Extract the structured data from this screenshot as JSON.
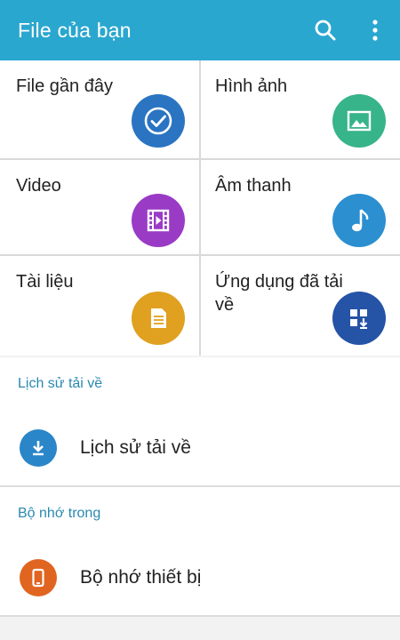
{
  "appbar": {
    "title": "File của bạn",
    "search_icon": "search-icon",
    "more_icon": "more-vert-icon",
    "color": "#2aa7cf"
  },
  "categories": [
    {
      "label": "File gần đây",
      "icon": "check-clock-icon",
      "color": "#2a74c2"
    },
    {
      "label": "Hình ảnh",
      "icon": "image-icon",
      "color": "#37b489"
    },
    {
      "label": "Video",
      "icon": "film-icon",
      "color": "#9a3bc6"
    },
    {
      "label": "Âm thanh",
      "icon": "music-note-icon",
      "color": "#2b8fd0"
    },
    {
      "label": "Tài liệu",
      "icon": "document-icon",
      "color": "#e0a020"
    },
    {
      "label": "Ứng dụng đã tải về",
      "icon": "app-download-icon",
      "color": "#2553a6"
    }
  ],
  "sections": [
    {
      "header": "Lịch sử tải về",
      "item": {
        "label": "Lịch sử tải về",
        "icon": "download-icon",
        "color": "#2a86c8"
      }
    },
    {
      "header": "Bộ nhớ trong",
      "item": {
        "label": "Bộ nhớ thiết bị",
        "icon": "phone-icon",
        "color": "#e06520"
      }
    }
  ]
}
